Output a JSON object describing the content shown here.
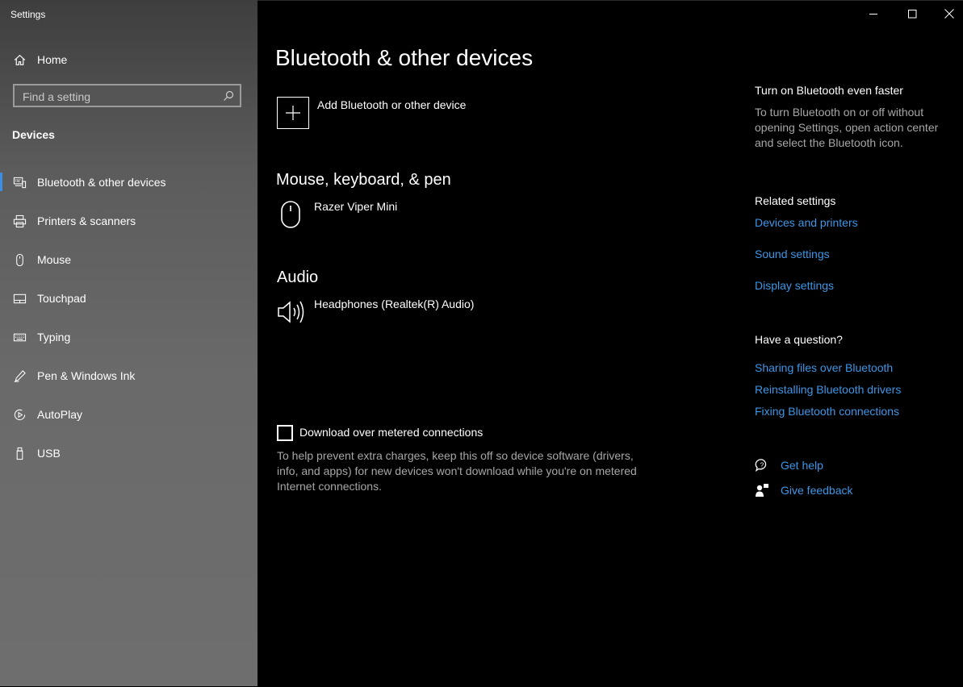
{
  "window": {
    "title": "Settings"
  },
  "sidebar": {
    "home_label": "Home",
    "search_placeholder": "Find a setting",
    "section": "Devices",
    "items": [
      {
        "label": "Bluetooth & other devices",
        "icon": "bluetooth-devices-icon",
        "active": true
      },
      {
        "label": "Printers & scanners",
        "icon": "printer-icon"
      },
      {
        "label": "Mouse",
        "icon": "mouse-icon"
      },
      {
        "label": "Touchpad",
        "icon": "touchpad-icon"
      },
      {
        "label": "Typing",
        "icon": "keyboard-icon"
      },
      {
        "label": "Pen & Windows Ink",
        "icon": "pen-icon"
      },
      {
        "label": "AutoPlay",
        "icon": "autoplay-icon"
      },
      {
        "label": "USB",
        "icon": "usb-icon"
      }
    ]
  },
  "main": {
    "title": "Bluetooth & other devices",
    "add_device_label": "Add Bluetooth or other device",
    "mouse_section": {
      "heading": "Mouse, keyboard, & pen",
      "device": "Razer Viper Mini"
    },
    "audio_section": {
      "heading": "Audio",
      "device": "Headphones (Realtek(R) Audio)"
    },
    "metered": {
      "label": "Download over metered connections",
      "checked": false,
      "description": "To help prevent extra charges, keep this off so device software (drivers, info, and apps) for new devices won't download while you're on metered Internet connections."
    }
  },
  "right": {
    "tip_heading": "Turn on Bluetooth even faster",
    "tip_text": "To turn Bluetooth on or off without opening Settings, open action center and select the Bluetooth icon.",
    "related_heading": "Related settings",
    "related_links": [
      "Devices and printers",
      "Sound settings",
      "Display settings"
    ],
    "question_heading": "Have a question?",
    "question_links": [
      "Sharing files over Bluetooth",
      "Reinstalling Bluetooth drivers",
      "Fixing Bluetooth connections"
    ],
    "get_help": "Get help",
    "give_feedback": "Give feedback"
  },
  "colors": {
    "accent": "#3a8ee6",
    "link": "#3d96e6",
    "secondary_text": "#a6a6a6",
    "background": "#000000"
  }
}
